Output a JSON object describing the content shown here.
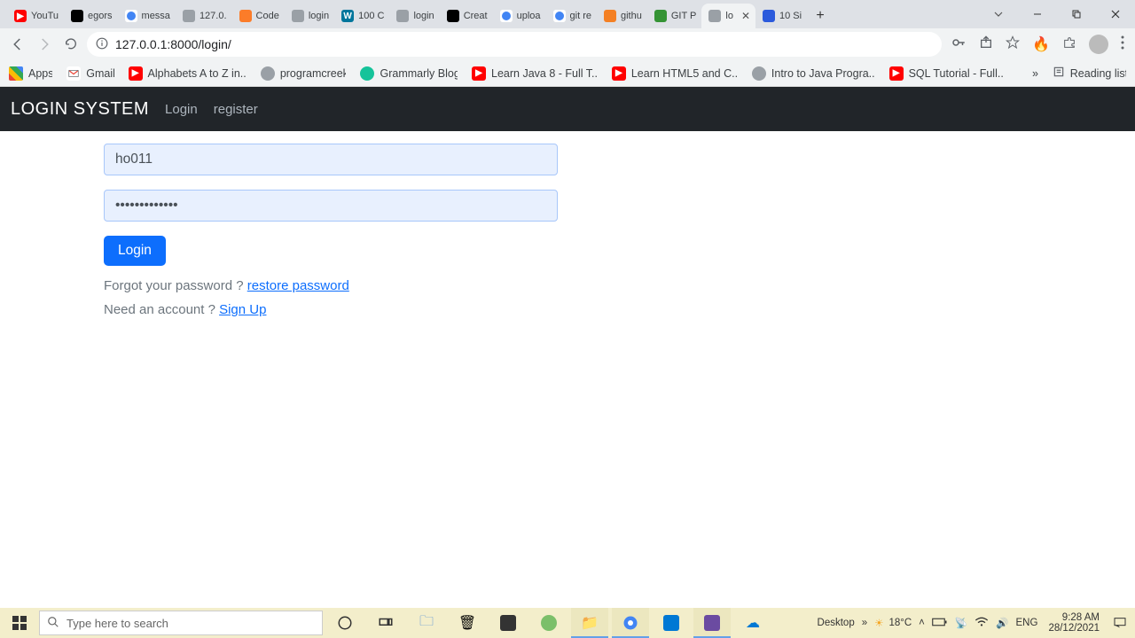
{
  "browser": {
    "tabs": [
      {
        "label": "YouTu"
      },
      {
        "label": "egors"
      },
      {
        "label": "messa"
      },
      {
        "label": "127.0."
      },
      {
        "label": "Code"
      },
      {
        "label": "login"
      },
      {
        "label": "100 C"
      },
      {
        "label": "login"
      },
      {
        "label": "Creat"
      },
      {
        "label": "uploa"
      },
      {
        "label": "git re"
      },
      {
        "label": "githu"
      },
      {
        "label": "GIT P"
      },
      {
        "label": "lo",
        "active": true
      },
      {
        "label": "10 Si"
      }
    ],
    "url": "127.0.0.1:8000/login/"
  },
  "bookmarks": {
    "items": [
      {
        "label": "Apps"
      },
      {
        "label": "Gmail"
      },
      {
        "label": "Alphabets A to Z in..."
      },
      {
        "label": "programcreek"
      },
      {
        "label": "Grammarly Blog"
      },
      {
        "label": "Learn Java 8 - Full T..."
      },
      {
        "label": "Learn HTML5 and C..."
      },
      {
        "label": "Intro to Java Progra..."
      },
      {
        "label": "SQL Tutorial - Full..."
      }
    ],
    "reading_list": "Reading list"
  },
  "page": {
    "brand": "LOGIN SYSTEM",
    "nav": {
      "login": "Login",
      "register": "register"
    },
    "form": {
      "username_value": "ho011",
      "password_value": "•••••••••••••",
      "login_button": "Login",
      "forgot_text": "Forgot your password ? ",
      "forgot_link": "restore password",
      "need_text": "Need an account ? ",
      "signup_link": "Sign Up"
    }
  },
  "taskbar": {
    "search_placeholder": "Type here to search",
    "desktop_label": "Desktop",
    "lang": "ENG",
    "weather": "18°C",
    "time": "9:28 AM",
    "date": "28/12/2021"
  }
}
